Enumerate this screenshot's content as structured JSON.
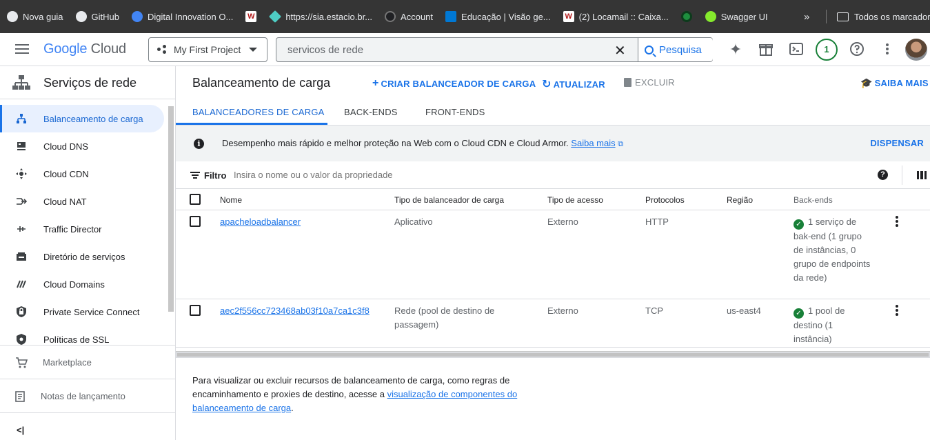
{
  "bookmarks": {
    "items": [
      {
        "label": "Nova guia",
        "icon": "globe-icon",
        "color": "#e8eaed"
      },
      {
        "label": "GitHub",
        "icon": "github-icon",
        "color": "#e8eaed"
      },
      {
        "label": "Digital Innovation O...",
        "icon": "dio-icon",
        "color": "#4285f4"
      },
      {
        "label": "",
        "icon": "w-icon",
        "color": "#b31b1b"
      },
      {
        "label": "https://sia.estacio.br...",
        "icon": "diamond-icon",
        "color": "#4ecdc4"
      },
      {
        "label": "Account",
        "icon": "account-icon",
        "color": "#202124"
      },
      {
        "label": "Educação | Visão ge...",
        "icon": "azure-icon",
        "color": "#0078d4"
      },
      {
        "label": "(2) Locamail :: Caixa...",
        "icon": "w-icon",
        "color": "#b31b1b"
      },
      {
        "label": "",
        "icon": "green-circle-icon",
        "color": "#1e8e3e"
      },
      {
        "label": "Swagger UI",
        "icon": "swagger-icon",
        "color": "#85ea2d"
      }
    ],
    "more": "»",
    "all_bookmarks": "Todos os marcadores"
  },
  "topbar": {
    "logo_google": "Google",
    "logo_cloud": "Cloud",
    "project": "My First Project",
    "search_value": "servicos de rede",
    "search_button": "Pesquisa",
    "notifications": "1"
  },
  "sidebar": {
    "title": "Serviços de rede",
    "items": [
      {
        "label": "Balanceamento de carga",
        "icon": "load-balancing-icon"
      },
      {
        "label": "Cloud DNS",
        "icon": "dns-icon"
      },
      {
        "label": "Cloud CDN",
        "icon": "cdn-icon"
      },
      {
        "label": "Cloud NAT",
        "icon": "nat-icon"
      },
      {
        "label": "Traffic Director",
        "icon": "traffic-director-icon"
      },
      {
        "label": "Diretório de serviços",
        "icon": "service-directory-icon"
      },
      {
        "label": "Cloud Domains",
        "icon": "domains-icon"
      },
      {
        "label": "Private Service Connect",
        "icon": "private-connect-icon"
      },
      {
        "label": "Políticas de SSL",
        "icon": "ssl-shield-icon"
      }
    ],
    "marketplace": "Marketplace",
    "release_notes": "Notas de lançamento",
    "collapse": "<|"
  },
  "main": {
    "title": "Balanceamento de carga",
    "actions": {
      "create": "CRIAR BALANCEADOR DE CARGA",
      "refresh": "ATUALIZAR",
      "delete": "EXCLUIR",
      "learn": "SAIBA MAIS"
    },
    "tabs": [
      "BALANCEADORES DE CARGA",
      "BACK-ENDS",
      "FRONT-ENDS"
    ],
    "banner": {
      "text": "Desempenho mais rápido e melhor proteção na Web com o Cloud CDN e Cloud Armor.",
      "link": "Saiba mais",
      "dismiss": "DISPENSAR"
    },
    "filter": {
      "label": "Filtro",
      "placeholder": "Insira o nome ou o valor da propriedade"
    },
    "table": {
      "headers": [
        "Nome",
        "Tipo de balanceador de carga",
        "Tipo de acesso",
        "Protocolos",
        "Região",
        "Back-ends"
      ],
      "rows": [
        {
          "name": "apacheloadbalancer",
          "type": "Aplicativo",
          "access": "Externo",
          "protocol": "HTTP",
          "region": "",
          "backends": "1 serviço de bak-end (1 grupo de instâncias, 0 grupo de endpoints da rede)"
        },
        {
          "name": "aec2f556cc723468ab03f10a7ca1c3f8",
          "type": "Rede (pool de destino de passagem)",
          "access": "Externo",
          "protocol": "TCP",
          "region": "us-east4",
          "backends": "1 pool de destino (1 instância)"
        }
      ]
    },
    "footer": {
      "text": "Para visualizar ou excluir recursos de balanceamento de carga, como regras de encaminhamento e proxies de destino, acesse a",
      "link": "visualização de componentes do balanceamento de carga",
      "end": "."
    }
  }
}
